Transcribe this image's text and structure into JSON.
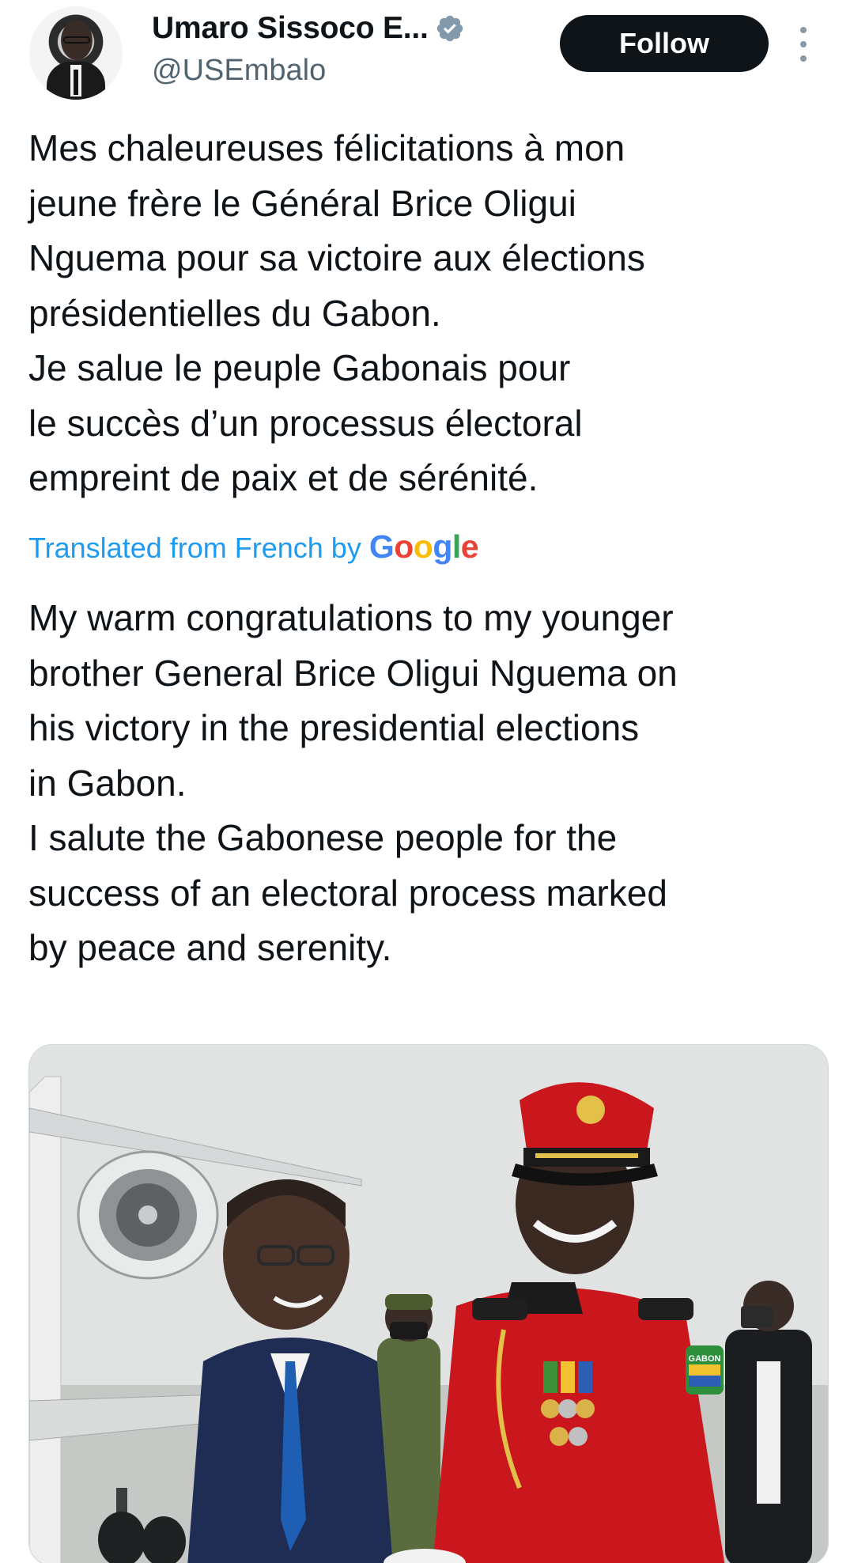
{
  "author": {
    "name": "Umaro Sissoco E...",
    "handle": "@USEmbalo",
    "verified": true
  },
  "actions": {
    "follow_label": "Follow",
    "more_icon": "more-vertical-icon"
  },
  "tweet": {
    "french_lines": [
      "Mes chaleureuses félicitations à mon",
      "jeune frère le Général Brice Oligui",
      "Nguema pour sa victoire aux élections",
      "présidentielles du Gabon.",
      "Je salue le peuple Gabonais pour",
      "le succès d’un processus électoral",
      "empreint de paix et de sérénité."
    ],
    "translation_label": "Translated from French by",
    "translation_provider": "Google",
    "english_lines": [
      "My warm congratulations to my younger",
      "brother General Brice Oligui Nguema on",
      "his victory in the presidential elections",
      "in Gabon.",
      "I salute the Gabonese people for the",
      "success of an electoral process marked",
      "by peace and serenity."
    ]
  },
  "media": {
    "badge_text": "GABON"
  },
  "colors": {
    "text": "#0f1419",
    "secondary": "#536471",
    "link": "#1d9bf0",
    "verified": "#829aab",
    "follow_bg": "#0f1419"
  }
}
